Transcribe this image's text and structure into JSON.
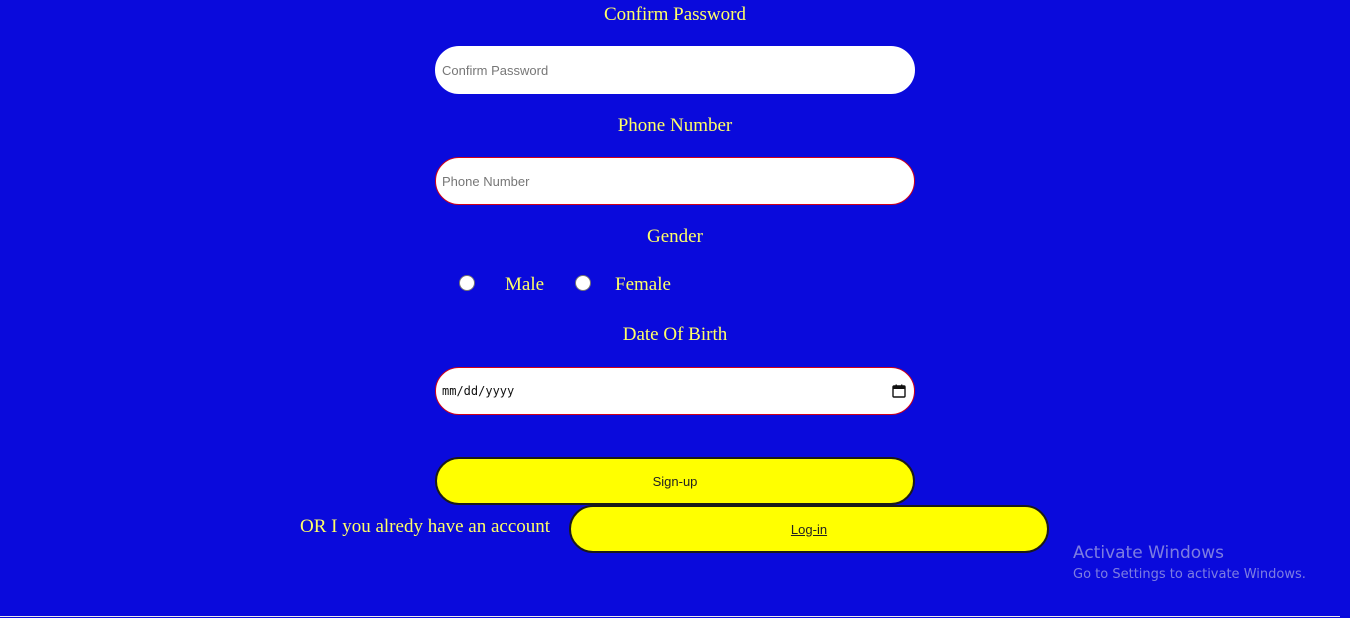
{
  "form": {
    "confirm_password": {
      "label": "Confirm Password",
      "placeholder": "Confirm Password"
    },
    "phone": {
      "label": "Phone Number",
      "placeholder": "Phone Number"
    },
    "gender": {
      "label": "Gender",
      "options": [
        "Male",
        "Female"
      ]
    },
    "dob": {
      "label": "Date Of Birth",
      "placeholder": "mm/dd/yyyy"
    },
    "signup_label": "Sign-up",
    "login_prompt": "OR I you alredy have an account",
    "login_label": "Log-in"
  },
  "watermark": {
    "title": "Activate Windows",
    "subtitle": "Go to Settings to activate Windows."
  },
  "colors": {
    "background": "#0a0adc",
    "label_text": "#ffff66",
    "button_bg": "#ffff00",
    "field_border_red": "#d0001a"
  },
  "icons": {
    "date_picker": "calendar-icon"
  }
}
